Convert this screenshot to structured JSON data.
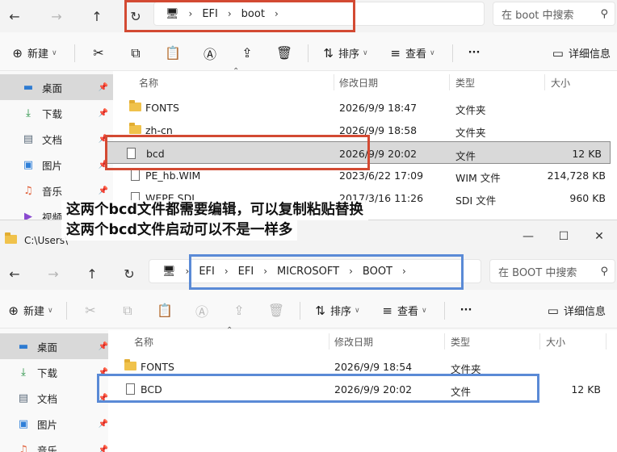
{
  "window1": {
    "nav": {
      "back": "←",
      "forward": "→",
      "up": "↑",
      "refresh": "↻"
    },
    "breadcrumbs": [
      "EFI",
      "boot"
    ],
    "search_placeholder": "在 boot 中搜索",
    "toolbar": {
      "new_label": "新建",
      "sort_label": "排序",
      "view_label": "查看",
      "more_label": "···",
      "details_label": "详细信息"
    },
    "sidebar": [
      {
        "label": "桌面",
        "icon": "desktop-icon",
        "selected": true
      },
      {
        "label": "下载",
        "icon": "download-icon"
      },
      {
        "label": "文档",
        "icon": "document-icon"
      },
      {
        "label": "图片",
        "icon": "picture-icon"
      },
      {
        "label": "音乐",
        "icon": "music-icon"
      },
      {
        "label": "视频",
        "icon": "video-icon"
      }
    ],
    "columns": {
      "name": "名称",
      "date": "修改日期",
      "type": "类型",
      "size": "大小"
    },
    "files": [
      {
        "name": "FONTS",
        "date": "2026/9/9 18:47",
        "type": "文件夹",
        "size": "",
        "kind": "folder"
      },
      {
        "name": "zh-cn",
        "date": "2026/9/9 18:58",
        "type": "文件夹",
        "size": "",
        "kind": "folder"
      },
      {
        "name": "bcd",
        "date": "2026/9/9 20:02",
        "type": "文件",
        "size": "12 KB",
        "kind": "file",
        "selected": true
      },
      {
        "name": "PE_hb.WIM",
        "date": "2023/6/22 17:09",
        "type": "WIM 文件",
        "size": "214,728 KB",
        "kind": "file"
      },
      {
        "name": "WEPE.SDI",
        "date": "2017/3/16 11:26",
        "type": "SDI 文件",
        "size": "960 KB",
        "kind": "file"
      }
    ]
  },
  "annotation": {
    "line1": "这两个bcd文件都需要编辑，可以复制粘贴替换",
    "line2": "这两个bcd文件启动可以不是一样多"
  },
  "window2": {
    "title": "C:\\Users\\",
    "nav": {
      "back": "←",
      "forward": "→",
      "up": "↑",
      "refresh": "↻"
    },
    "breadcrumbs": [
      "EFI",
      "EFI",
      "MICROSOFT",
      "BOOT"
    ],
    "search_placeholder": "在 BOOT 中搜索",
    "toolbar": {
      "new_label": "新建",
      "sort_label": "排序",
      "view_label": "查看",
      "more_label": "···",
      "details_label": "详细信息"
    },
    "sidebar": [
      {
        "label": "桌面",
        "icon": "desktop-icon",
        "selected": true
      },
      {
        "label": "下载",
        "icon": "download-icon"
      },
      {
        "label": "文档",
        "icon": "document-icon"
      },
      {
        "label": "图片",
        "icon": "picture-icon"
      },
      {
        "label": "音乐",
        "icon": "music-icon"
      }
    ],
    "columns": {
      "name": "名称",
      "date": "修改日期",
      "type": "类型",
      "size": "大小"
    },
    "files": [
      {
        "name": "FONTS",
        "date": "2026/9/9 18:54",
        "type": "文件夹",
        "size": "",
        "kind": "folder"
      },
      {
        "name": "BCD",
        "date": "2026/9/9 20:02",
        "type": "文件",
        "size": "12 KB",
        "kind": "file"
      }
    ]
  },
  "colors": {
    "highlight_red": "#d34a33",
    "highlight_blue": "#5a8ad6",
    "selection": "#d9d9d9"
  }
}
